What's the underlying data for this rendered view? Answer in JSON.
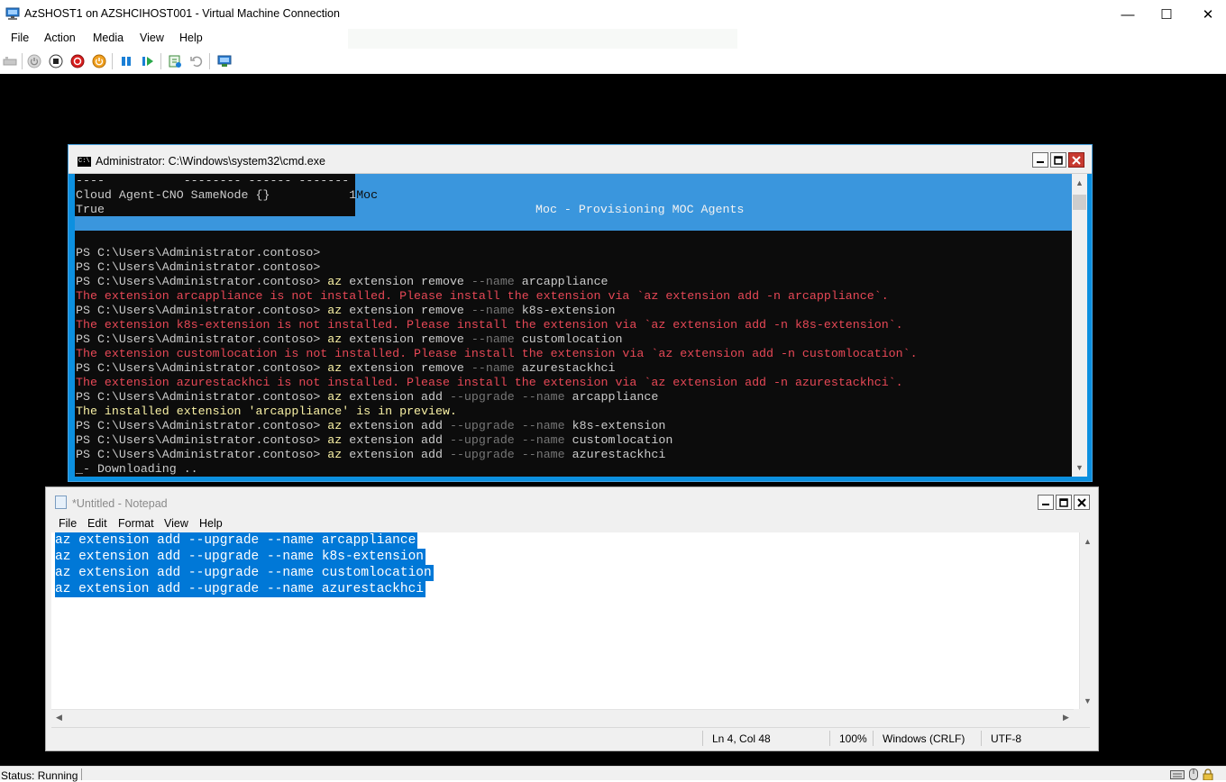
{
  "window": {
    "title": "AzSHOST1 on AZSHCIHOST001 - Virtual Machine Connection",
    "minimize_glyph": "—",
    "maximize_glyph": "☐",
    "close_glyph": "✕"
  },
  "menubar": {
    "items": [
      "File",
      "Action",
      "Media",
      "View",
      "Help"
    ]
  },
  "toolbar": {
    "icons": [
      "ctrl-alt-del-icon",
      "start-icon",
      "turn-off-icon",
      "shut-down-icon",
      "power-icon",
      "pause-icon",
      "resume-icon",
      "checkpoint-icon",
      "revert-icon",
      "enhanced-session-icon"
    ]
  },
  "status": {
    "text": "Status: Running"
  },
  "cmd": {
    "title": "Administrator: C:\\Windows\\system32\\cmd.exe",
    "progress_header": "----           -------- ------ -------",
    "progress_row": "Cloud Agent-CNO SameNode {}           1",
    "progress_row_tail": "Moc",
    "progress_true": "True",
    "progress_activity": "Moc - Provisioning MOC Agents",
    "prompt": "PS C:\\Users\\Administrator.contoso>",
    "lines": [
      {
        "prompt": "PS C:\\Users\\Administrator.contoso>",
        "cmd": "",
        "param": "",
        "arg": ""
      },
      {
        "prompt": "PS C:\\Users\\Administrator.contoso>",
        "cmd": "",
        "param": "",
        "arg": ""
      },
      {
        "prompt": "PS C:\\Users\\Administrator.contoso>",
        "cmd": "az",
        "rest": " extension remove ",
        "param": "--name",
        "arg": " arcappliance"
      },
      {
        "error": "The extension arcappliance is not installed. Please install the extension via `az extension add -n arcappliance`."
      },
      {
        "prompt": "PS C:\\Users\\Administrator.contoso>",
        "cmd": "az",
        "rest": " extension remove ",
        "param": "--name",
        "arg": " k8s-extension"
      },
      {
        "error": "The extension k8s-extension is not installed. Please install the extension via `az extension add -n k8s-extension`."
      },
      {
        "prompt": "PS C:\\Users\\Administrator.contoso>",
        "cmd": "az",
        "rest": " extension remove ",
        "param": "--name",
        "arg": " customlocation"
      },
      {
        "error": "The extension customlocation is not installed. Please install the extension via `az extension add -n customlocation`."
      },
      {
        "prompt": "PS C:\\Users\\Administrator.contoso>",
        "cmd": "az",
        "rest": " extension remove ",
        "param": "--name",
        "arg": " azurestackhci"
      },
      {
        "error": "The extension azurestackhci is not installed. Please install the extension via `az extension add -n azurestackhci`."
      },
      {
        "prompt": "PS C:\\Users\\Administrator.contoso>",
        "cmd": "az",
        "rest": " extension add ",
        "param": "--upgrade --name",
        "arg": " arcappliance"
      },
      {
        "warn": "The installed extension 'arcappliance' is in preview."
      },
      {
        "prompt": "PS C:\\Users\\Administrator.contoso>",
        "cmd": "az",
        "rest": " extension add ",
        "param": "--upgrade --name",
        "arg": " k8s-extension"
      },
      {
        "prompt": "PS C:\\Users\\Administrator.contoso>",
        "cmd": "az",
        "rest": " extension add ",
        "param": "--upgrade --name",
        "arg": " customlocation"
      },
      {
        "prompt": "PS C:\\Users\\Administrator.contoso>",
        "cmd": "az",
        "rest": " extension add ",
        "param": "--upgrade --name",
        "arg": " azurestackhci"
      },
      {
        "plain": "_- Downloading .."
      }
    ]
  },
  "notepad": {
    "title": "*Untitled - Notepad",
    "menu": [
      "File",
      "Edit",
      "Format",
      "View",
      "Help"
    ],
    "lines": [
      "az extension add --upgrade --name arcappliance",
      "az extension add --upgrade --name k8s-extension",
      "az extension add --upgrade --name customlocation",
      "az extension add --upgrade --name azurestackhci"
    ],
    "status": {
      "position": "Ln 4, Col 48",
      "zoom": "100%",
      "line_ending": "Windows (CRLF)",
      "encoding": "UTF-8"
    }
  }
}
